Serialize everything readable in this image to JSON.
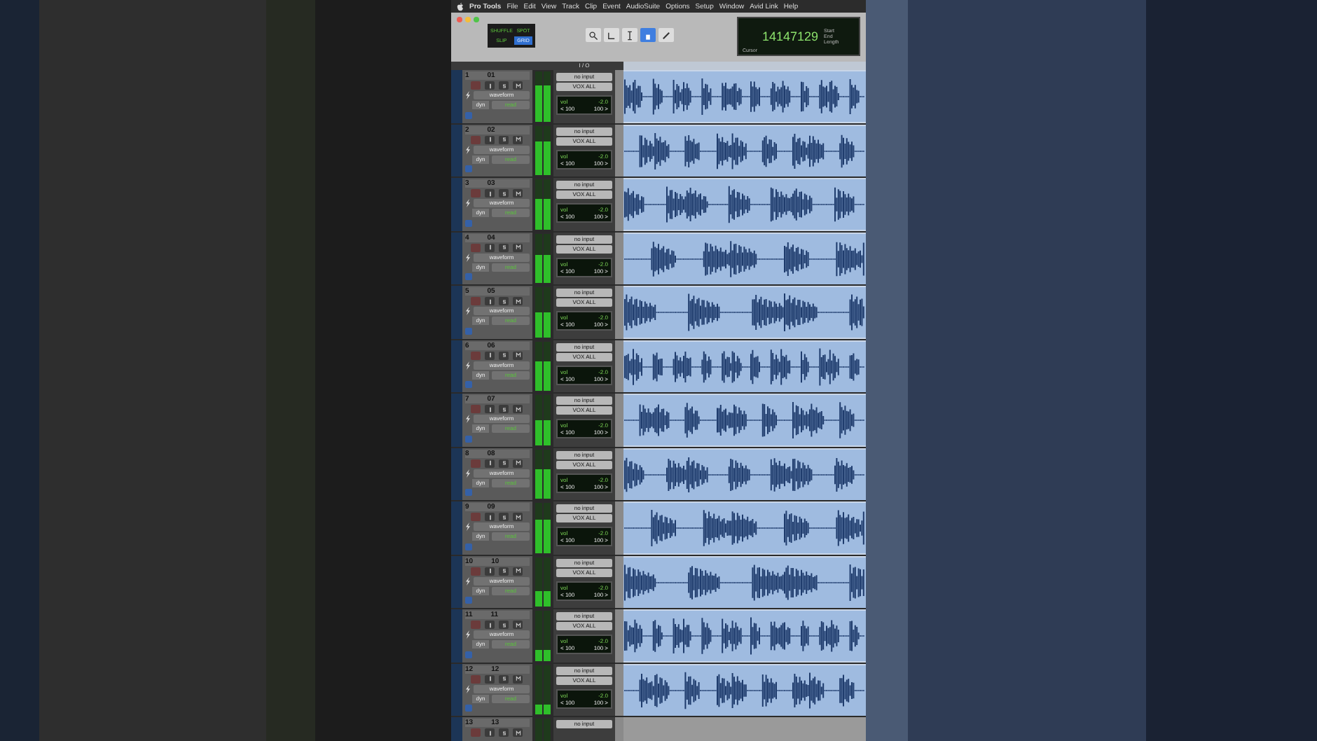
{
  "menu_bar": {
    "items": [
      "Pro Tools",
      "File",
      "Edit",
      "View",
      "Track",
      "Clip",
      "Event",
      "AudioSuite",
      "Options",
      "Setup",
      "Window",
      "Avid Link",
      "Help"
    ]
  },
  "toolbar": {
    "edit_modes": [
      {
        "label": "SHUFFLE",
        "selected": false
      },
      {
        "label": "SPOT",
        "selected": false
      },
      {
        "label": "SLIP",
        "selected": false
      },
      {
        "label": "GRID",
        "selected": true
      }
    ],
    "counter": {
      "value": "14147129",
      "labels": [
        "Start",
        "End",
        "Length"
      ],
      "cursor_label": "Cursor"
    }
  },
  "io_header": "I / O",
  "tracks": [
    {
      "number": "1",
      "name": "01",
      "view": "waveform",
      "dyn": "dyn",
      "automation": "read",
      "input": "no input",
      "output": "VOX ALL",
      "vol_label": "vol",
      "vol": "-2.0",
      "pan_left": "< 100",
      "pan_right": "100 >",
      "level": 0.72
    },
    {
      "number": "2",
      "name": "02",
      "view": "waveform",
      "dyn": "dyn",
      "automation": "read",
      "input": "no input",
      "output": "VOX ALL",
      "vol_label": "vol",
      "vol": "-2.0",
      "pan_left": "< 100",
      "pan_right": "100 >",
      "level": 0.68
    },
    {
      "number": "3",
      "name": "03",
      "view": "waveform",
      "dyn": "dyn",
      "automation": "read",
      "input": "no input",
      "output": "VOX ALL",
      "vol_label": "vol",
      "vol": "-2.0",
      "pan_left": "< 100",
      "pan_right": "100 >",
      "level": 0.6
    },
    {
      "number": "4",
      "name": "04",
      "view": "waveform",
      "dyn": "dyn",
      "automation": "read",
      "input": "no input",
      "output": "VOX ALL",
      "vol_label": "vol",
      "vol": "-2.0",
      "pan_left": "< 100",
      "pan_right": "100 >",
      "level": 0.55
    },
    {
      "number": "5",
      "name": "05",
      "view": "waveform",
      "dyn": "dyn",
      "automation": "read",
      "input": "no input",
      "output": "VOX ALL",
      "vol_label": "vol",
      "vol": "-2.0",
      "pan_left": "< 100",
      "pan_right": "100 >",
      "level": 0.5
    },
    {
      "number": "6",
      "name": "06",
      "view": "waveform",
      "dyn": "dyn",
      "automation": "read",
      "input": "no input",
      "output": "VOX ALL",
      "vol_label": "vol",
      "vol": "-2.0",
      "pan_left": "< 100",
      "pan_right": "100 >",
      "level": 0.6
    },
    {
      "number": "7",
      "name": "07",
      "view": "waveform",
      "dyn": "dyn",
      "automation": "read",
      "input": "no input",
      "output": "VOX ALL",
      "vol_label": "vol",
      "vol": "-2.0",
      "pan_left": "< 100",
      "pan_right": "100 >",
      "level": 0.5
    },
    {
      "number": "8",
      "name": "08",
      "view": "waveform",
      "dyn": "dyn",
      "automation": "read",
      "input": "no input",
      "output": "VOX ALL",
      "vol_label": "vol",
      "vol": "-2.0",
      "pan_left": "< 100",
      "pan_right": "100 >",
      "level": 0.6
    },
    {
      "number": "9",
      "name": "09",
      "view": "waveform",
      "dyn": "dyn",
      "automation": "read",
      "input": "no input",
      "output": "VOX ALL",
      "vol_label": "vol",
      "vol": "-2.0",
      "pan_left": "< 100",
      "pan_right": "100 >",
      "level": 0.65
    },
    {
      "number": "10",
      "name": "10",
      "view": "waveform",
      "dyn": "dyn",
      "automation": "read",
      "input": "no input",
      "output": "VOX ALL",
      "vol_label": "vol",
      "vol": "-2.0",
      "pan_left": "< 100",
      "pan_right": "100 >",
      "level": 0.3
    },
    {
      "number": "11",
      "name": "11",
      "view": "waveform",
      "dyn": "dyn",
      "automation": "read",
      "input": "no input",
      "output": "VOX ALL",
      "vol_label": "vol",
      "vol": "-2.0",
      "pan_left": "< 100",
      "pan_right": "100 >",
      "level": 0.2
    },
    {
      "number": "12",
      "name": "12",
      "view": "waveform",
      "dyn": "dyn",
      "automation": "read",
      "input": "no input",
      "output": "VOX ALL",
      "vol_label": "vol",
      "vol": "-2.0",
      "pan_left": "< 100",
      "pan_right": "100 >",
      "level": 0.2
    },
    {
      "number": "13",
      "name": "13",
      "input": "no input"
    }
  ]
}
